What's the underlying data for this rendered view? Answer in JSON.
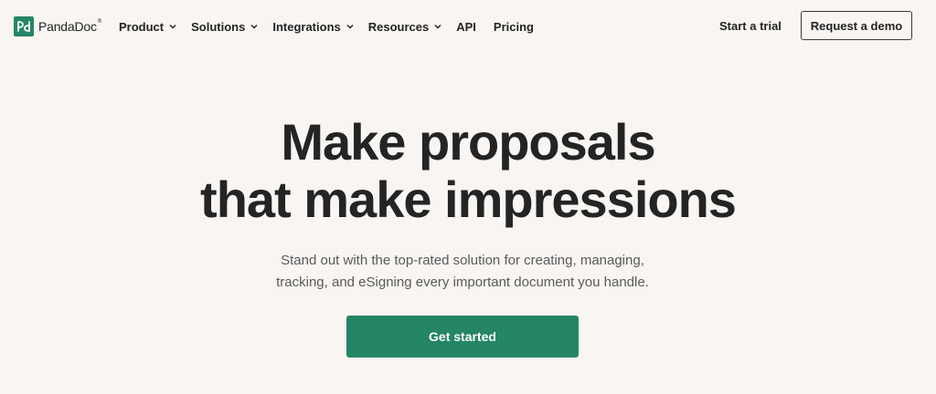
{
  "header": {
    "logo_text": "PandaDoc",
    "logo_reg": "®",
    "nav": [
      {
        "label": "Product",
        "has_menu": true
      },
      {
        "label": "Solutions",
        "has_menu": true
      },
      {
        "label": "Integrations",
        "has_menu": true
      },
      {
        "label": "Resources",
        "has_menu": true
      },
      {
        "label": "API",
        "has_menu": false
      },
      {
        "label": "Pricing",
        "has_menu": false
      }
    ],
    "trial_label": "Start a trial",
    "demo_label": "Request a demo"
  },
  "hero": {
    "title_line1": "Make proposals",
    "title_line2": "that make impressions",
    "subtitle_line1": "Stand out with the top-rated solution for creating, managing,",
    "subtitle_line2": "tracking, and eSigning every important document you handle.",
    "cta_label": "Get started"
  },
  "colors": {
    "brand_green": "#248567",
    "background": "#f8f5f2",
    "text": "#242424"
  }
}
